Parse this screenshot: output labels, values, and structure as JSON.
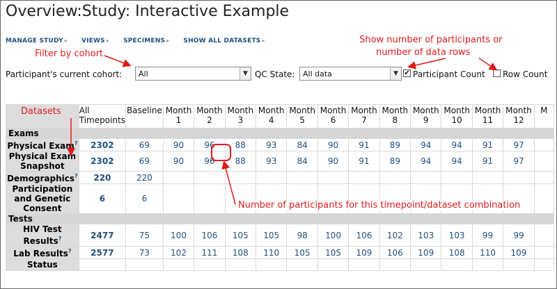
{
  "page": {
    "title": "Overview:Study: Interactive Example"
  },
  "nav": {
    "items": [
      "MANAGE STUDY",
      "VIEWS",
      "SPECIMENS",
      "SHOW ALL DATASETS"
    ]
  },
  "filters": {
    "cohort_label": "Participant's current cohort:",
    "cohort_value": "All",
    "qc_label": "QC State:",
    "qc_value": "All data",
    "participant_count_label": "Participant Count",
    "participant_count_checked": true,
    "row_count_label": "Row Count",
    "row_count_checked": false
  },
  "annotations": {
    "filter_by_cohort": "Filter by cohort",
    "show_number_line1": "Show number of participants or",
    "show_number_line2": "number of data rows",
    "datasets": "Datasets",
    "number_of_participants": "Number of participants for this timepoint/dataset combination"
  },
  "colors": {
    "annotation": "#e11b1b",
    "link": "#1f4f82",
    "header_bg": "#d6d6d6"
  },
  "grid": {
    "columns": [
      "All\nTimepoints",
      "Baseline",
      "Month\n1",
      "Month\n2",
      "Month\n3",
      "Month\n4",
      "Month\n5",
      "Month\n6",
      "Month\n7",
      "Month\n8",
      "Month\n9",
      "Month\n10",
      "Month\n11",
      "Month\n12",
      "M"
    ],
    "categories": [
      {
        "name": "Exams",
        "rows": [
          {
            "name": "Physical Exam",
            "help": true,
            "total": "2302",
            "values": [
              "69",
              "90",
              "96",
              "88",
              "93",
              "84",
              "90",
              "91",
              "89",
              "94",
              "94",
              "91",
              "97",
              ""
            ]
          },
          {
            "name": "Physical Exam Snapshot",
            "help": false,
            "total": "2302",
            "values": [
              "69",
              "90",
              "96",
              "88",
              "93",
              "84",
              "90",
              "91",
              "89",
              "94",
              "94",
              "91",
              "97",
              ""
            ]
          },
          {
            "name": "Demographics",
            "help": true,
            "total": "220",
            "values": [
              "220",
              "",
              "",
              "",
              "",
              "",
              "",
              "",
              "",
              "",
              "",
              "",
              "",
              ""
            ]
          },
          {
            "name": "Participation and Genetic Consent",
            "help": false,
            "total": "6",
            "values": [
              "6",
              "",
              "",
              "",
              "",
              "",
              "",
              "",
              "",
              "",
              "",
              "",
              "",
              ""
            ]
          }
        ]
      },
      {
        "name": "Tests",
        "rows": [
          {
            "name": "HIV Test Results",
            "help": true,
            "total": "2477",
            "values": [
              "75",
              "100",
              "106",
              "105",
              "105",
              "98",
              "100",
              "106",
              "102",
              "103",
              "103",
              "99",
              "99",
              ""
            ]
          },
          {
            "name": "Lab Results",
            "help": true,
            "total": "2577",
            "values": [
              "73",
              "102",
              "111",
              "108",
              "110",
              "105",
              "105",
              "109",
              "106",
              "109",
              "108",
              "110",
              "109",
              ""
            ]
          },
          {
            "name": "Status",
            "help": false,
            "total": "",
            "values": [
              "",
              "",
              "",
              "",
              "",
              "",
              "",
              "",
              "",
              "",
              "",
              "",
              "",
              ""
            ]
          }
        ]
      }
    ]
  }
}
